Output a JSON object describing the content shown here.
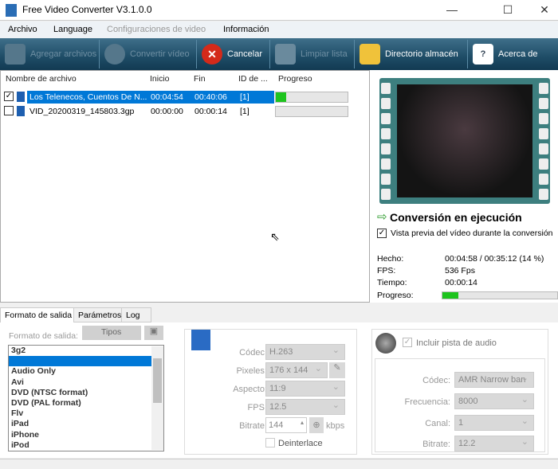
{
  "window": {
    "title": "Free Video Converter V3.1.0.0",
    "minimize": "—",
    "maximize": "☐",
    "close": "✕"
  },
  "menu": [
    "Archivo",
    "Language",
    "Configuraciones de video",
    "Información"
  ],
  "toolbar": [
    {
      "label": "Agregar archivos",
      "icon": "add-file-icon",
      "enabled": false
    },
    {
      "label": "Convertir vídeo",
      "icon": "convert-icon",
      "enabled": false
    },
    {
      "label": "Cancelar",
      "icon": "cancel-icon",
      "enabled": true
    },
    {
      "label": "Limpiar lista",
      "icon": "clear-list-icon",
      "enabled": false
    },
    {
      "label": "Directorio almacén",
      "icon": "folder-icon",
      "enabled": true
    },
    {
      "label": "Acerca de",
      "icon": "help-icon",
      "enabled": true
    }
  ],
  "list": {
    "headers": [
      "Nombre de archivo",
      "Inicio",
      "Fin",
      "ID de ...",
      "Progreso"
    ],
    "rows": [
      {
        "checked": true,
        "selected": true,
        "name": "Los Telenecos, Cuentos De N...",
        "start": "00:04:54",
        "end": "00:40:06",
        "id": "[1]",
        "progress": 14
      },
      {
        "checked": false,
        "selected": false,
        "name": "VID_20200319_145803.3gp",
        "start": "00:00:00",
        "end": "00:00:14",
        "id": "[1]",
        "progress": 0
      }
    ]
  },
  "preview": {
    "status": "Conversión en ejecución",
    "preview_checkbox": "Vista previa del vídeo durante la conversión",
    "done_label": "Hecho:",
    "done_value": "00:04:58 / 00:35:12  (14 %)",
    "fps_label": "FPS:",
    "fps_value": "536 Fps",
    "time_label": "Tiempo:",
    "time_value": "00:00:14",
    "progress_label": "Progreso:",
    "progress": 14
  },
  "tabs": [
    "Formato de salida",
    "Parámetros",
    "Log"
  ],
  "output": {
    "label": "Formato de salida:",
    "types_button": "Tipos",
    "formats": [
      "3g2",
      "3gp",
      "Audio Only",
      "Avi",
      "DVD (NTSC format)",
      "DVD (PAL format)",
      "Flv",
      "iPad",
      "iPhone",
      "iPod"
    ],
    "selected": "3gp"
  },
  "video": {
    "codec_label": "Códec:",
    "codec": "H.263",
    "pixels_label": "Pixeles:",
    "pixels": "176 x 144",
    "aspect_label": "Aspecto:",
    "aspect": "11:9",
    "fps_label": "FPS:",
    "fps": "12.5",
    "bitrate_label": "Bitrate:",
    "bitrate": "144",
    "bitrate_unit": "kbps",
    "deinterlace": "Deinterlace"
  },
  "audio": {
    "include": "Incluir pista de audio",
    "codec_label": "Códec:",
    "codec": "AMR Narrow ban",
    "freq_label": "Frecuencia:",
    "freq": "8000",
    "channel_label": "Canal:",
    "channel": "1",
    "bitrate_label": "Bitrate:",
    "bitrate": "12.2"
  },
  "colors": {
    "accent": "#0078d7",
    "progress": "#1ec41e",
    "toolbar": "#1e4c66"
  }
}
